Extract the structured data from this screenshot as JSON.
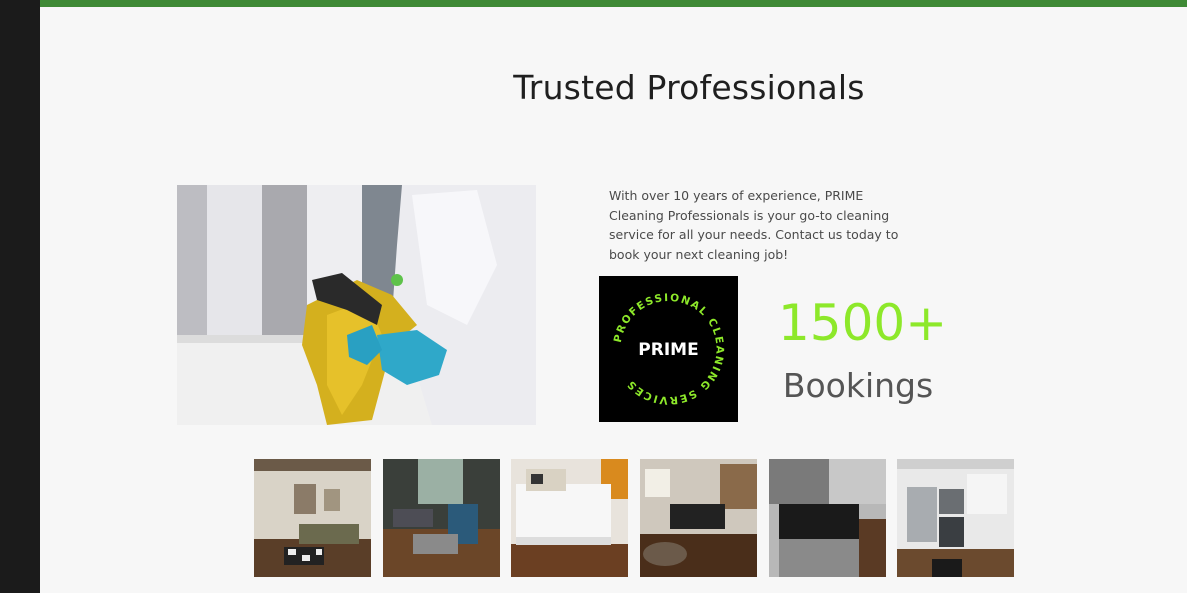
{
  "section": {
    "title": "Trusted Professionals",
    "description_lines": [
      "With over 10 years of experience, PRIME",
      "Cleaning Professionals is your go-to cleaning",
      "service for all your needs. Contact us today to",
      "book your next cleaning job!"
    ]
  },
  "logo": {
    "brand": "PRIME",
    "ring_text": "PROFESSIONAL CLEANING SERVICES",
    "accent_color": "#8de82a"
  },
  "stat": {
    "number": "1500+",
    "label": "Bookings"
  },
  "colors": {
    "topbar": "#3f8a36",
    "accent": "#8de82a",
    "page_bg": "#f7f7f7",
    "outer_bg": "#1b1b1b"
  },
  "images": {
    "hero": "cleaner-wiping-counter-photo",
    "gallery": [
      "living-room-photo",
      "dining-living-photo",
      "bedroom-photo",
      "open-living-kitchen-photo",
      "kitchen-stove-photo",
      "kitchen-appliances-photo"
    ]
  }
}
